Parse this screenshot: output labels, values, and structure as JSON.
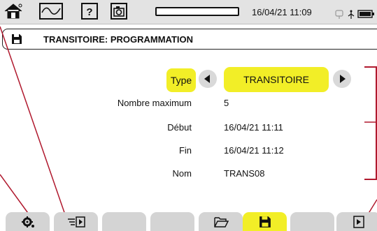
{
  "status_bar": {
    "datetime": "16/04/21 11:09",
    "icons": [
      "home-icon",
      "waveform-icon",
      "help-icon",
      "camera-icon",
      "battery-indicator",
      "usb-icon",
      "network-icon",
      "battery-icon"
    ],
    "battery_level": 0.0
  },
  "title_bar": {
    "icon": "save-icon",
    "title": "TRANSITOIRE: PROGRAMMATION"
  },
  "form": {
    "type": {
      "label": "Type",
      "value": "TRANSITOIRE"
    },
    "max_number": {
      "label": "Nombre maximum",
      "value": "5"
    },
    "start": {
      "label": "Début",
      "value": "16/04/21 11:11"
    },
    "end": {
      "label": "Fin",
      "value": "16/04/21 11:12"
    },
    "name": {
      "label": "Nom",
      "value": "TRANS08"
    }
  },
  "bottom_bar": {
    "keys": [
      "settings-icon",
      "filter-play-icon",
      "",
      "",
      "open-folder-icon",
      "save-icon",
      "",
      "play-icon"
    ],
    "active_key": "save-icon"
  },
  "colors": {
    "highlight": "#f2ee27",
    "annotation": "#b0192e",
    "key_gray": "#d4d4d4",
    "status_gray": "#e3e3e3"
  }
}
